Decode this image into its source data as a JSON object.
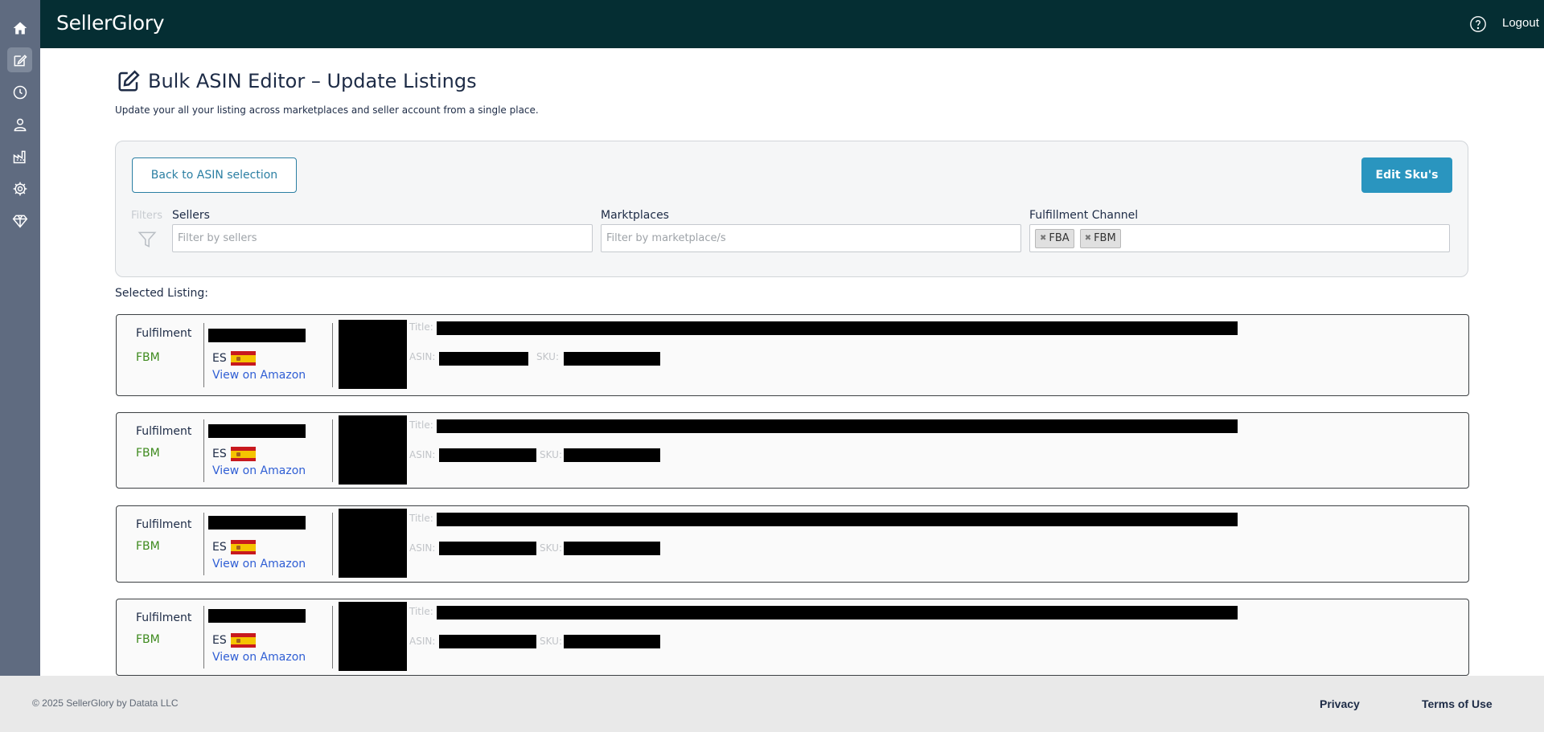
{
  "app": {
    "brand": "SellerGlory",
    "logout_label": "Logout"
  },
  "sidebar": {
    "items": [
      {
        "name": "home",
        "icon": "home-icon",
        "active": false
      },
      {
        "name": "bulk-editor",
        "icon": "edit-icon",
        "active": true
      },
      {
        "name": "history",
        "icon": "clock-icon",
        "active": false
      },
      {
        "name": "account",
        "icon": "user-icon",
        "active": false
      },
      {
        "name": "reports",
        "icon": "factory-icon",
        "active": false
      },
      {
        "name": "settings",
        "icon": "gear-icon",
        "active": false
      },
      {
        "name": "premium",
        "icon": "diamond-icon",
        "active": false
      }
    ]
  },
  "page": {
    "title": "Bulk ASIN Editor – Update Listings",
    "subtitle": "Update your all your listing across marketplaces and seller account from a single place."
  },
  "toolbar": {
    "back_label": "Back to ASIN selection",
    "edit_label": "Edit Sku's"
  },
  "filters": {
    "label": "Filters",
    "sellers": {
      "label": "Sellers",
      "placeholder": "Filter by sellers"
    },
    "marketplaces": {
      "label": "Marktplaces",
      "placeholder": "Filter by marketplace/s"
    },
    "fulfillment": {
      "label": "Fulfillment Channel",
      "tags": [
        "FBA",
        "FBM"
      ]
    }
  },
  "listings_section": {
    "label": "Selected Listing:",
    "items": [
      {
        "fulfilment_label": "Fulfilment",
        "channel": "FBM",
        "country": "ES",
        "link": "View on Amazon",
        "title_label": "Title:",
        "asin_label": "ASIN:",
        "sku_label": "SKU:"
      },
      {
        "fulfilment_label": "Fulfilment",
        "channel": "FBM",
        "country": "ES",
        "link": "View on Amazon",
        "title_label": "Title:",
        "asin_label": "ASIN:",
        "sku_label": "SKU:"
      },
      {
        "fulfilment_label": "Fulfilment",
        "channel": "FBM",
        "country": "ES",
        "link": "View on Amazon",
        "title_label": "Title:",
        "asin_label": "ASIN:",
        "sku_label": "SKU:"
      },
      {
        "fulfilment_label": "Fulfilment",
        "channel": "FBM",
        "country": "ES",
        "link": "View on Amazon",
        "title_label": "Title:",
        "asin_label": "ASIN:",
        "sku_label": "SKU:"
      }
    ]
  },
  "footer": {
    "copyright": "© 2025 SellerGlory by Datata LLC",
    "privacy": "Privacy",
    "terms": "Terms of Use"
  },
  "colors": {
    "topbar": "#052e33",
    "sidebar": "#5f6b80",
    "accent": "#2a95bf",
    "fbm": "#3e8a1e",
    "link": "#2f5ed4"
  }
}
